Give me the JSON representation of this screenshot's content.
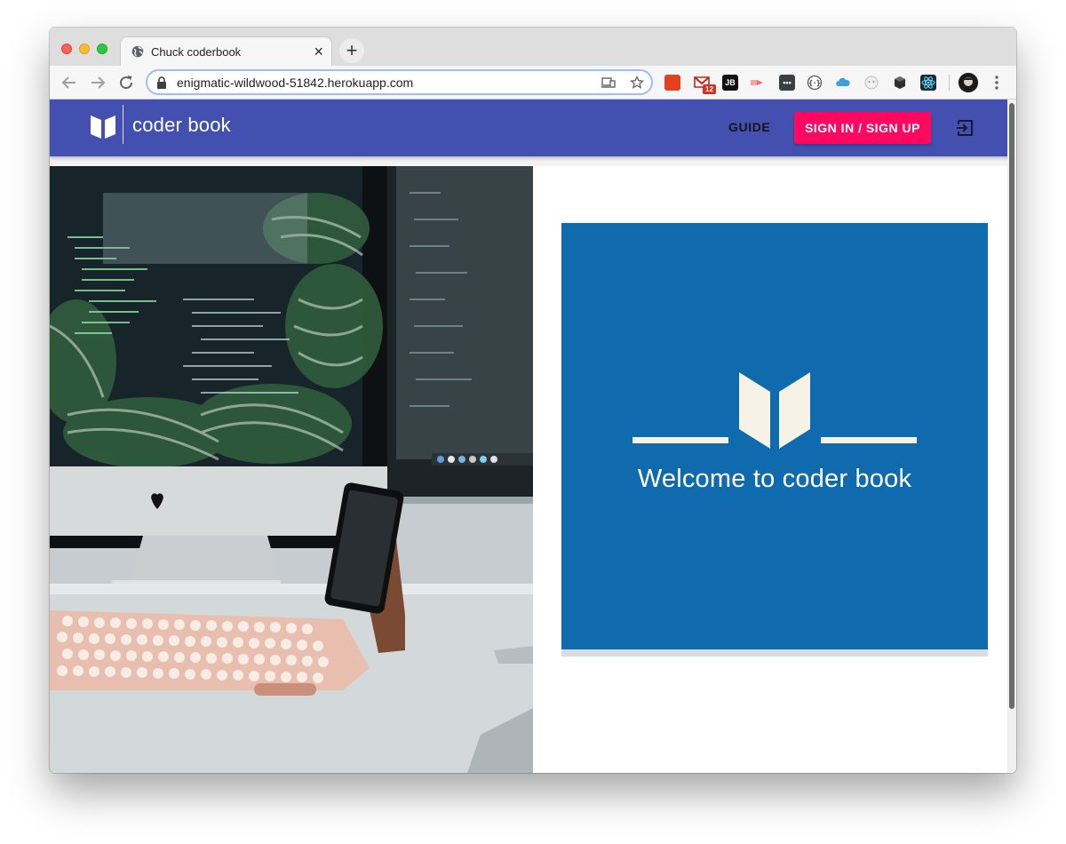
{
  "browser": {
    "tab": {
      "title": "Chuck coderbook",
      "close_glyph": "×"
    },
    "new_tab_glyph": "+",
    "address": {
      "url": "enigmatic-wildwood-51842.herokuapp.com"
    },
    "extensions": [
      {
        "name": "office-icon",
        "color": "#e2421a"
      },
      {
        "name": "gmail-icon",
        "badge": "12",
        "color": "#c5221f"
      },
      {
        "name": "jetbrains-icon",
        "label": "JB",
        "color": "#111111"
      },
      {
        "name": "cast-ext-icon",
        "color": "#f26a6a"
      },
      {
        "name": "lastpass-icon",
        "label": "•••",
        "color": "#3a3f44"
      },
      {
        "name": "json-viewer-icon",
        "color": "#555555"
      },
      {
        "name": "cloud-icon",
        "color": "#3d9ee0"
      },
      {
        "name": "face-ext-icon",
        "color": "#cfcfcf"
      },
      {
        "name": "cube-icon",
        "color": "#2f2f2f"
      },
      {
        "name": "react-devtools-icon",
        "color": "#1a2b34"
      }
    ]
  },
  "appbar": {
    "brand": "coder book",
    "guide_label": "GUIDE",
    "signin_label": "SIGN IN / SIGN UP",
    "color": "#4450b0",
    "signin_color": "#ff0960"
  },
  "hero": {
    "welcome": "Welcome to coder book",
    "color": "#0f6aae"
  }
}
